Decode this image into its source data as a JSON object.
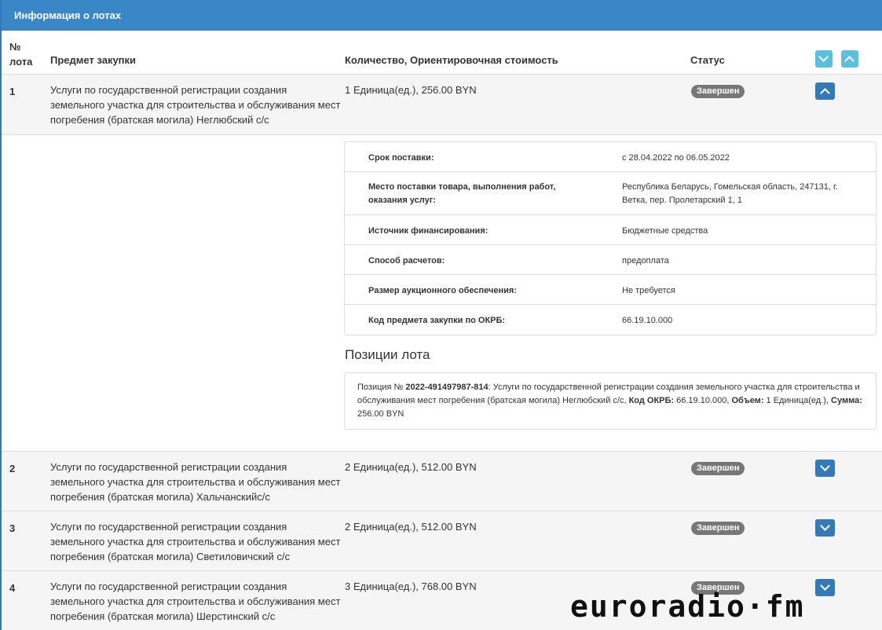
{
  "panel": {
    "title": "Информация о лотах"
  },
  "columns": {
    "num_line1": "№",
    "num_line2": "лота",
    "subject": "Предмет закупки",
    "qty": "Количество, Ориентировочная стоимость",
    "status": "Статус"
  },
  "lots": [
    {
      "num": "1",
      "subject": "Услуги по государственной регистрации создания земельного участка для строительства и обслуживания мест погребения (братская могила) Неглюбский с/с",
      "qty": "1 Единица(ед.), 256.00 BYN",
      "status": "Завершен"
    },
    {
      "num": "2",
      "subject": "Услуги по государственной регистрации создания земельного участка для строительства и обслуживания мест погребения (братская могила) Хальчанскийс/с",
      "qty": "2 Единица(ед.), 512.00 BYN",
      "status": "Завершен"
    },
    {
      "num": "3",
      "subject": "Услуги по государственной регистрации создания земельного участка для строительства и обслуживания мест погребения (братская могила) Светиловичский с/с",
      "qty": "2 Единица(ед.), 512.00 BYN",
      "status": "Завершен"
    },
    {
      "num": "4",
      "subject": "Услуги по государственной регистрации создания земельного участка для строительства и обслуживания мест погребения (братская могила) Шерстинский с/с",
      "qty": "3 Единица(ед.), 768.00 BYN",
      "status": "Завершен"
    }
  ],
  "details": {
    "rows": [
      {
        "key": "Срок поставки:",
        "value": "с 28.04.2022 по 06.05.2022"
      },
      {
        "key": "Место поставки товара, выполнения работ, оказания услуг:",
        "value": "Республика Беларусь, Гомельская область, 247131, г. Ветка, пер. Пролетарский 1, 1"
      },
      {
        "key": "Источник финансирования:",
        "value": "Бюджетные средства"
      },
      {
        "key": "Способ расчетов:",
        "value": "предоплата"
      },
      {
        "key": "Размер аукционного обеспечения:",
        "value": "Не требуется"
      },
      {
        "key": "Код предмета закупки по ОКРБ:",
        "value": "66.19.10.000"
      }
    ],
    "positions_title": "Позиции лота",
    "position": {
      "prefix": "Позиция № ",
      "code": "2022-491497987-814",
      "text": ": Услуги по государственной регистрации создания земельного участка для строительства и обслуживания мест погребения (братская могила) Неглюбский с/с, ",
      "okrb_label": "Код ОКРБ:",
      "okrb_value": " 66.19.10.000, ",
      "volume_label": "Объем:",
      "volume_value": " 1 Единица(ед.), ",
      "sum_label": "Сумма:",
      "sum_value": " 256.00 BYN"
    }
  },
  "watermark": "euroradio·fm"
}
